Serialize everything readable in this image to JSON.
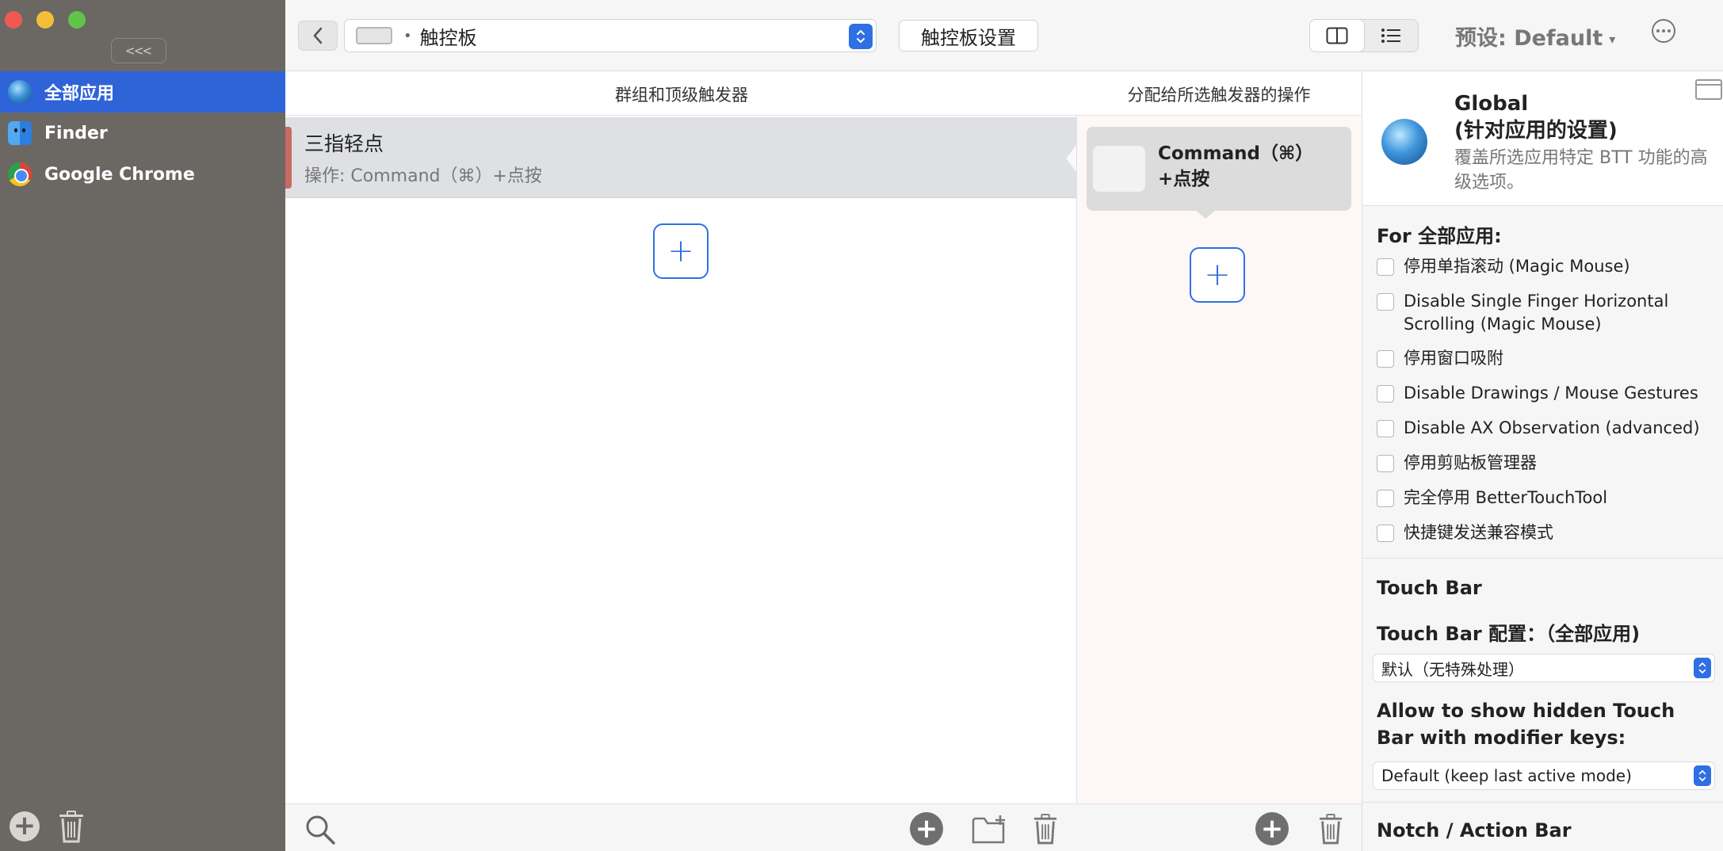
{
  "sidebar": {
    "collapse_label": "<<<",
    "apps": [
      {
        "name": "全部应用",
        "icon": "globe-icon",
        "selected": true
      },
      {
        "name": "Finder",
        "icon": "finder-icon",
        "selected": false
      },
      {
        "name": "Google Chrome",
        "icon": "chrome-icon",
        "selected": false
      }
    ]
  },
  "toolbar": {
    "device_label": "触控板",
    "device_bullet": "•",
    "settings_button": "触控板设置",
    "preset_label": "预设: Default",
    "preset_caret": "▾"
  },
  "columns": {
    "triggers_header": "群组和顶级触发器",
    "actions_header": "分配给所选触发器的操作"
  },
  "trigger": {
    "title": "三指轻点",
    "subtitle": "操作: Command（⌘）+点按"
  },
  "action": {
    "line1": "Command（⌘）",
    "line2": "+点按"
  },
  "plus_symbol": "+",
  "right_panel": {
    "title_line1": "Global",
    "title_line2": "(针对应用的设置)",
    "description": "覆盖所选应用特定 BTT 功能的高级选项。",
    "for_all_label": "For 全部应用:",
    "checkboxes": [
      "停用单指滚动 (Magic Mouse)",
      "Disable Single Finger Horizontal Scrolling (Magic Mouse)",
      "停用窗口吸附",
      "Disable Drawings / Mouse Gestures",
      "Disable AX Observation (advanced)",
      "停用剪贴板管理器",
      "完全停用 BetterTouchTool",
      "快捷键发送兼容模式"
    ],
    "touchbar_section": "Touch Bar",
    "touchbar_config_label": "Touch Bar 配置：（全部应用)",
    "touchbar_config_value": "默认（无特殊处理）",
    "hidden_touchbar_label": "Allow to show hidden Touch Bar with modifier keys:",
    "hidden_touchbar_value": "Default (keep last active mode)",
    "notch_section": "Notch / Action Bar"
  },
  "colors": {
    "accent": "#2f6fe4",
    "sidebar_bg": "#6b6864",
    "sidebar_selected": "#2f63d8",
    "trigger_accent": "#c96a64"
  }
}
